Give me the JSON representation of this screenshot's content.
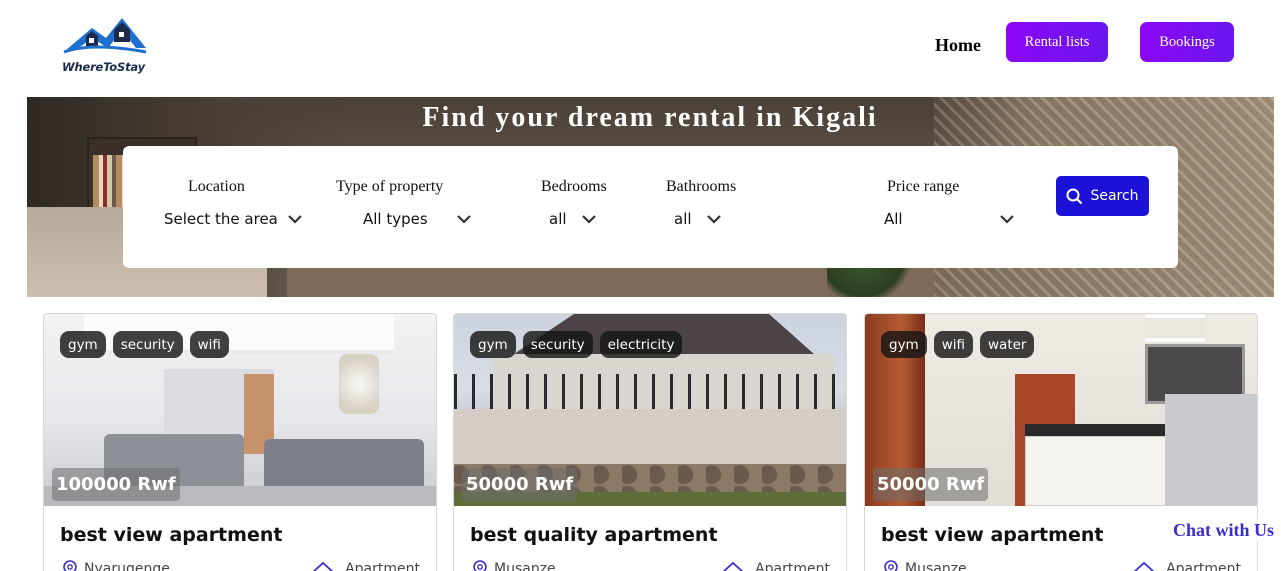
{
  "header": {
    "logo_text": "WhereToStay",
    "nav": {
      "home": "Home",
      "rental_lists": "Rental lists",
      "bookings": "Bookings"
    }
  },
  "hero": {
    "title": "Find your dream rental in Kigali"
  },
  "search": {
    "fields": [
      {
        "label": "Location",
        "value": "Select the area"
      },
      {
        "label": "Type of property",
        "value": "All types"
      },
      {
        "label": "Bedrooms",
        "value": "all"
      },
      {
        "label": "Bathrooms",
        "value": "all"
      },
      {
        "label": "Price range",
        "value": "All"
      }
    ],
    "button_label": "Search"
  },
  "listings": [
    {
      "tags": [
        "gym",
        "security",
        "wifi"
      ],
      "price": "100000 Rwf",
      "title": "best view apartment",
      "location": "Nyarugenge",
      "type": "Apartment"
    },
    {
      "tags": [
        "gym",
        "security",
        "electricity"
      ],
      "price": "50000 Rwf",
      "title": "best quality apartment",
      "location": "Musanze",
      "type": "Apartment"
    },
    {
      "tags": [
        "gym",
        "wifi",
        "water"
      ],
      "price": "50000 Rwf",
      "title": "best view apartment",
      "location": "Musanze",
      "type": "Apartment"
    }
  ],
  "chat": {
    "label": "Chat with Us"
  },
  "colors": {
    "nav_button": "#7c0ff2",
    "search_button": "#1c11d6",
    "chat_text": "#3b2ed0",
    "logo_blue": "#1f6fd1"
  }
}
